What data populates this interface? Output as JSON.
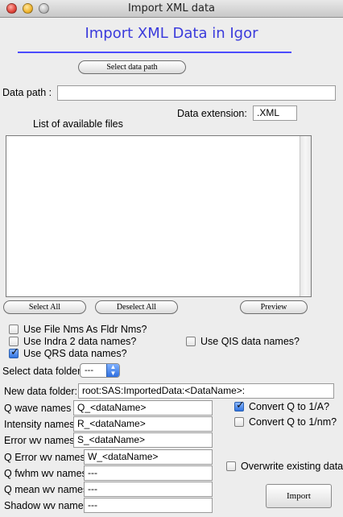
{
  "window": {
    "title": "Import XML data"
  },
  "heading": "Import XML Data in Igor",
  "buttons": {
    "select_data_path": "Select data path",
    "select_all": "Select All",
    "deselect_all": "Deselect All",
    "preview": "Preview",
    "import": "Import"
  },
  "data_path": {
    "label": "Data path :",
    "value": ""
  },
  "data_extension": {
    "label": "Data extension:",
    "value": ".XML"
  },
  "file_list": {
    "label": "List of available files",
    "items": []
  },
  "checkboxes": {
    "use_file_nms": {
      "label": "Use File Nms As Fldr Nms?",
      "checked": false
    },
    "use_indra2": {
      "label": "Use Indra 2 data names?",
      "checked": false
    },
    "use_qrs": {
      "label": "Use QRS data names?",
      "checked": true
    },
    "use_qis": {
      "label": "Use QIS data names?",
      "checked": false
    },
    "convert_q_a": {
      "label": "Convert Q to 1/A?",
      "checked": true
    },
    "convert_q_nm": {
      "label": "Convert Q to 1/nm?",
      "checked": false
    },
    "overwrite": {
      "label": "Overwrite existing data?",
      "checked": false
    }
  },
  "select_folder": {
    "label": "Select data folder",
    "value": "---"
  },
  "new_folder": {
    "label": "New data folder:",
    "value": "root:SAS:ImportedData:<DataName>:"
  },
  "wave_names": {
    "q": {
      "label": "Q wave names",
      "value": "Q_<dataName>"
    },
    "intensity": {
      "label": "Intensity names",
      "value": "R_<dataName>"
    },
    "error": {
      "label": "Error wv names",
      "value": "S_<dataName>"
    },
    "q_error": {
      "label": "Q Error wv names",
      "value": "W_<dataName>"
    },
    "q_fwhm": {
      "label": "Q fwhm wv names",
      "value": "---"
    },
    "q_mean": {
      "label": "Q mean wv names",
      "value": "---"
    },
    "shadow": {
      "label": "Shadow wv names",
      "value": "---"
    }
  }
}
